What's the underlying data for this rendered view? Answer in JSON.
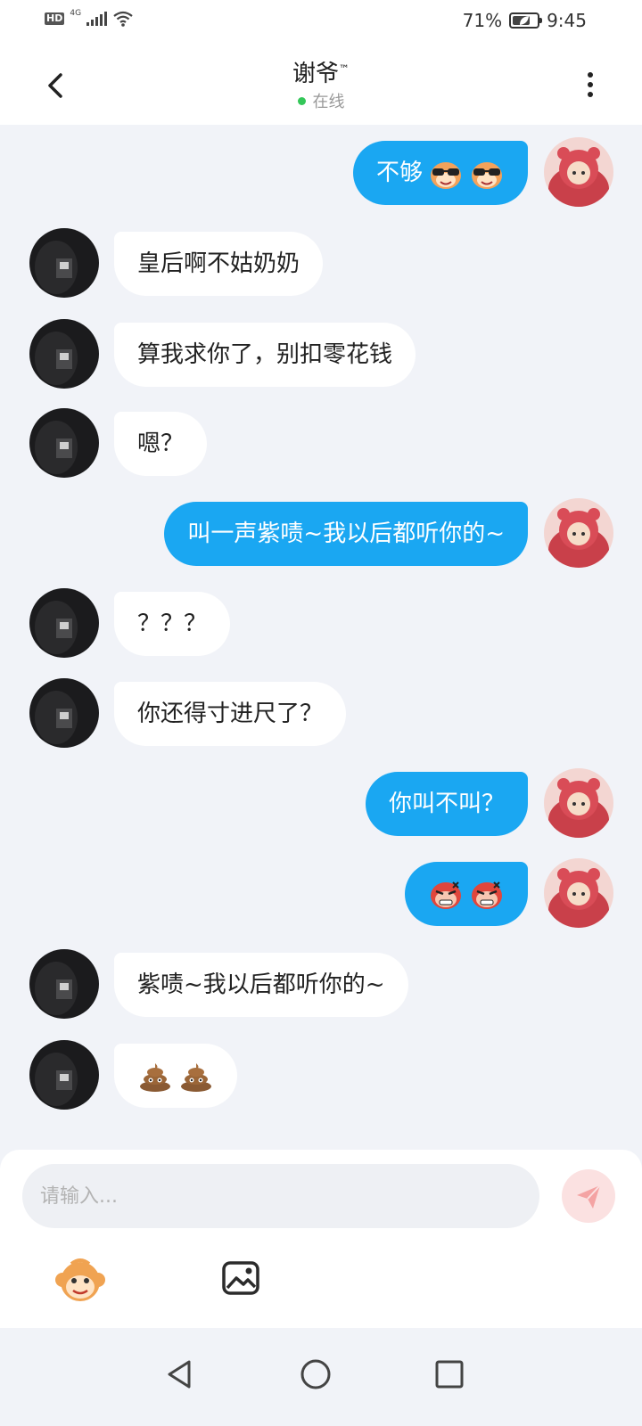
{
  "status_bar": {
    "network_badge": "HD",
    "network_type": "4G",
    "battery_percent": "71%",
    "battery_level": 0.71,
    "time": "9:45"
  },
  "header": {
    "title": "谢爷",
    "title_mark": "™",
    "status_text": "在线",
    "status_color": "#34c759"
  },
  "colors": {
    "my_bubble": "#1aa7f2",
    "their_bubble": "#ffffff",
    "background": "#f1f3f8"
  },
  "messages": [
    {
      "sender": "me",
      "text": "不够",
      "emojis": [
        "glasses-monkey-emoji",
        "glasses-monkey-emoji"
      ]
    },
    {
      "sender": "other",
      "text": "皇后啊不姑奶奶"
    },
    {
      "sender": "other",
      "text": "算我求你了，别扣零花钱"
    },
    {
      "sender": "other",
      "text": "嗯？"
    },
    {
      "sender": "me",
      "text": "叫一声紫啧~我以后都听你的~"
    },
    {
      "sender": "other",
      "text": "？？？"
    },
    {
      "sender": "other",
      "text": "你还得寸进尺了？"
    },
    {
      "sender": "me",
      "text": "你叫不叫？"
    },
    {
      "sender": "me",
      "text": "",
      "emojis": [
        "angry-face-emoji",
        "angry-face-emoji"
      ]
    },
    {
      "sender": "other",
      "text": "紫啧~我以后都听你的~"
    },
    {
      "sender": "other",
      "text": "",
      "emojis": [
        "poop-emoji",
        "poop-emoji"
      ]
    }
  ],
  "composer": {
    "placeholder": "请输入...",
    "value": ""
  },
  "icons": {
    "back": "back-chevron-icon",
    "more": "more-vertical-icon",
    "send": "send-icon",
    "emoji": "monkey-emoji-icon",
    "image": "image-icon"
  }
}
